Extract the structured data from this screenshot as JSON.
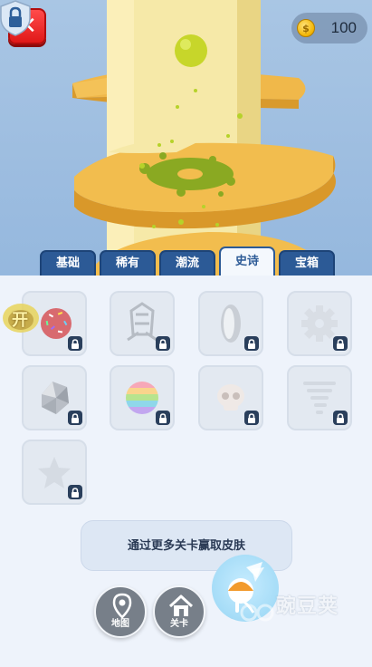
{
  "coins": {
    "count": "100",
    "icon": "coin-icon"
  },
  "tabs": [
    {
      "label": "基础",
      "active": false
    },
    {
      "label": "稀有",
      "active": false
    },
    {
      "label": "潮流",
      "active": false
    },
    {
      "label": "史诗",
      "active": true
    },
    {
      "label": "宝箱",
      "active": false
    }
  ],
  "skins": [
    {
      "name": "sprinkle-ball",
      "locked": true
    },
    {
      "name": "trophy-frame",
      "locked": true
    },
    {
      "name": "silver-lens",
      "locked": true
    },
    {
      "name": "gear",
      "locked": true
    },
    {
      "name": "crystal-gem",
      "locked": true
    },
    {
      "name": "rainbow-ball",
      "locked": true
    },
    {
      "name": "skull",
      "locked": true
    },
    {
      "name": "tornado",
      "locked": true
    },
    {
      "name": "star",
      "locked": true
    }
  ],
  "badge": {
    "text": "开"
  },
  "info": {
    "text": "通过更多关卡赢取皮肤"
  },
  "nav": {
    "map_label": "地图",
    "level_label": "关卡"
  },
  "watermark": {
    "text": "豌豆荚"
  },
  "colors": {
    "tab": "#2c5a96",
    "close": "#e01818",
    "ball": "#c7d62a"
  }
}
